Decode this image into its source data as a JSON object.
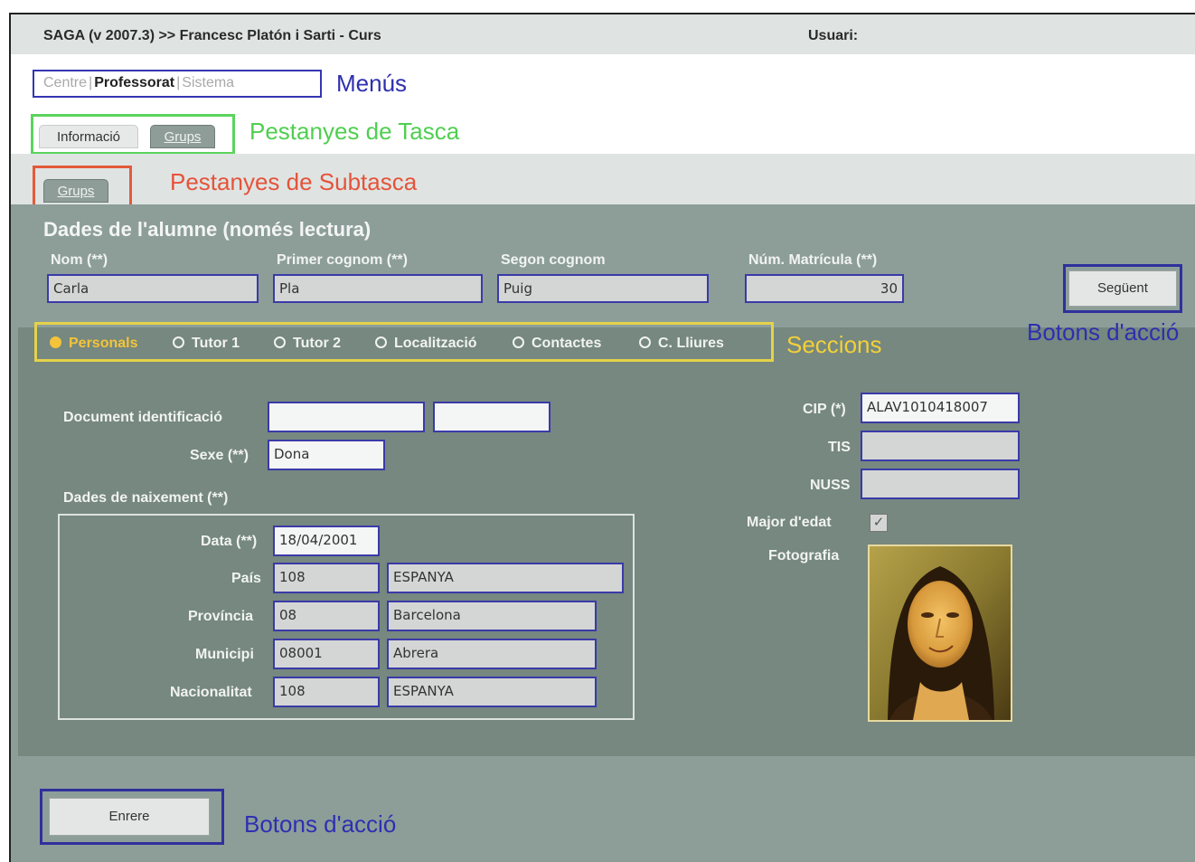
{
  "window": {
    "title": "SAGA (v 2007.3) >> Francesc Platón i Sarti - Curs",
    "user_label": "Usuari:"
  },
  "menus": {
    "items": [
      "Centre",
      "Professorat",
      "Sistema"
    ],
    "active": "Professorat",
    "separator": "|",
    "annotation": "Menús"
  },
  "task_tabs": {
    "items": [
      "Informació",
      "Grups"
    ],
    "active": "Grups",
    "annotation": "Pestanyes de Tasca"
  },
  "subtask_tabs": {
    "items": [
      "Grups"
    ],
    "annotation": "Pestanyes de Subtasca"
  },
  "student": {
    "header": "Dades de l'alumne (només lectura)",
    "fields": {
      "nom": {
        "label": "Nom (**)",
        "value": "Carla"
      },
      "cognom1": {
        "label": "Primer cognom (**)",
        "value": "Pla"
      },
      "cognom2": {
        "label": "Segon cognom",
        "value": "Puig"
      },
      "matricula": {
        "label": "Núm. Matrícula (**)",
        "value": "30"
      }
    }
  },
  "actions": {
    "next_label": "Següent",
    "back_label": "Enrere",
    "annotation_top": "Botons d'acció",
    "annotation_bottom": "Botons d'acció"
  },
  "sections": {
    "items": [
      "Personals",
      "Tutor 1",
      "Tutor 2",
      "Localització",
      "Contactes",
      "C. Lliures"
    ],
    "active": "Personals",
    "annotation": "Seccions"
  },
  "personal": {
    "doc_label": "Document identificació",
    "doc_value1": "",
    "doc_value2": "",
    "sexe_label": "Sexe (**)",
    "sexe_value": "Dona",
    "birth_title": "Dades de naixement (**)",
    "birth": {
      "data_label": "Data (**)",
      "data_value": "18/04/2001",
      "pais_label": "País",
      "pais_code": "108",
      "pais_name": "ESPANYA",
      "provincia_label": "Província",
      "provincia_code": "08",
      "provincia_name": "Barcelona",
      "municipi_label": "Municipi",
      "municipi_code": "08001",
      "municipi_name": "Abrera",
      "nacionalitat_label": "Nacionalitat",
      "nacionalitat_code": "108",
      "nacionalitat_name": "ESPANYA"
    },
    "cip_label": "CIP (*)",
    "cip_value": "ALAV1010418007",
    "tis_label": "TIS",
    "tis_value": "",
    "nuss_label": "NUSS",
    "nuss_value": "",
    "major_label": "Major d'edat",
    "major_checked": true,
    "photo_label": "Fotografia"
  },
  "colors": {
    "menus_annotation": "#2f2fb0",
    "task_annotation": "#4fcf4f",
    "subtask_annotation": "#e5533a",
    "sections_annotation": "#f2d03a",
    "actions_annotation": "#2f2fb0",
    "panel": "#8d9e99"
  }
}
